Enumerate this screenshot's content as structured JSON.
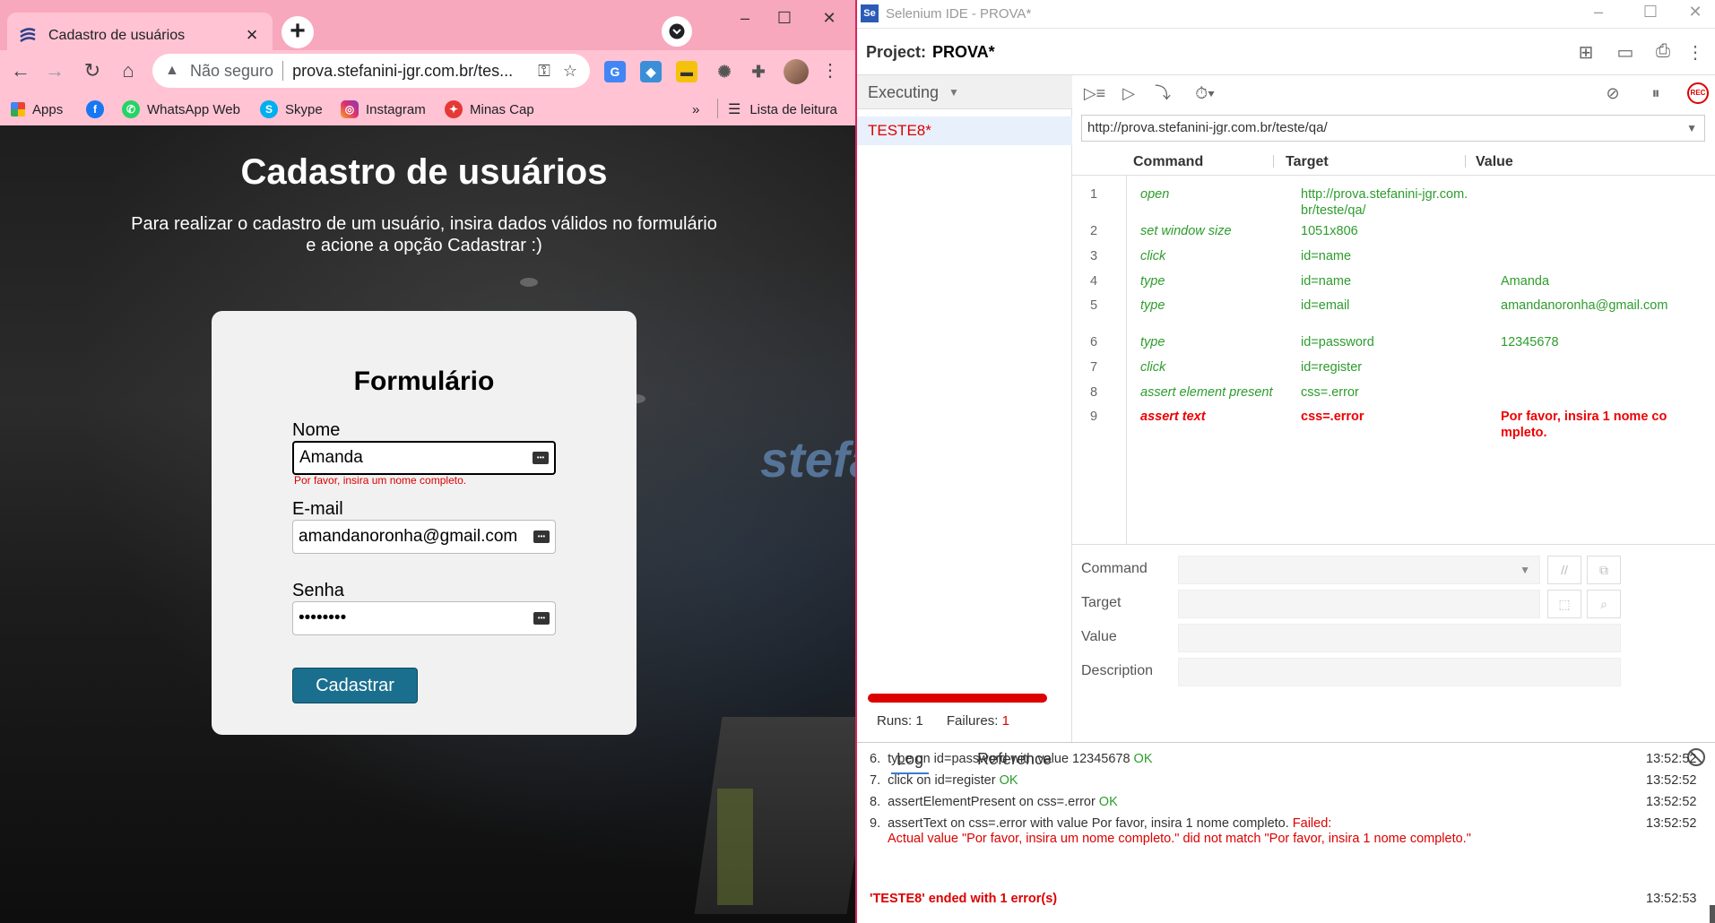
{
  "browser": {
    "tab_title": "Cadastro de usuários",
    "tab_close": "×",
    "new_tab": "+",
    "security_label": "Não seguro",
    "url": "prova.stefanini-jgr.com.br/tes...",
    "bookmarks": [
      "Apps",
      "WhatsApp Web",
      "Skype",
      "Instagram",
      "Minas Cap"
    ],
    "more_bookmarks": "»",
    "reading_list": "Lista de leitura"
  },
  "page": {
    "title": "Cadastro de usuários",
    "subtitle": "Para realizar o cadastro de um usuário, insira dados válidos no formulário e acione a opção Cadastrar :)",
    "form": {
      "heading": "Formulário",
      "name_label": "Nome",
      "name_value": "Amanda",
      "name_error": "Por favor, insira um nome completo.",
      "email_label": "E-mail",
      "email_value": "amandanoronha@gmail.com",
      "password_label": "Senha",
      "password_value": "••••••••",
      "submit_label": "Cadastrar"
    }
  },
  "ide": {
    "window_title": "Selenium IDE - PROVA*",
    "logo": "Se",
    "project_label": "Project:",
    "project_name": "PROVA*",
    "executing_label": "Executing",
    "test_name": "TESTE8*",
    "base_url": "http://prova.stefanini-jgr.com.br/teste/qa/",
    "rec_label": "REC",
    "columns": [
      "Command",
      "Target",
      "Value"
    ],
    "commands": [
      {
        "num": "1",
        "command": "open",
        "target": "http://prova.stefanini-jgr.com.br/teste/qa/",
        "value": "",
        "status": "ok"
      },
      {
        "num": "2",
        "command": "set window size",
        "target": "1051x806",
        "value": "",
        "status": "ok"
      },
      {
        "num": "3",
        "command": "click",
        "target": "id=name",
        "value": "",
        "status": "ok"
      },
      {
        "num": "4",
        "command": "type",
        "target": "id=name",
        "value": "Amanda",
        "status": "ok"
      },
      {
        "num": "5",
        "command": "type",
        "target": "id=email",
        "value": "amandanoronha@gmail.com",
        "status": "ok"
      },
      {
        "num": "6",
        "command": "type",
        "target": "id=password",
        "value": "12345678",
        "status": "ok"
      },
      {
        "num": "7",
        "command": "click",
        "target": "id=register",
        "value": "",
        "status": "ok"
      },
      {
        "num": "8",
        "command": "assert element present",
        "target": "css=.error",
        "value": "",
        "status": "ok"
      },
      {
        "num": "9",
        "command": "assert text",
        "target": "css=.error",
        "value": "Por favor, insira 1 nome completo.",
        "status": "fail"
      }
    ],
    "editor": {
      "command_label": "Command",
      "target_label": "Target",
      "value_label": "Value",
      "description_label": "Description",
      "comment_btn": "//"
    },
    "runs_label": "Runs:",
    "runs_value": "1",
    "failures_label": "Failures:",
    "failures_value": "1",
    "log_tabs": [
      "Log",
      "Reference"
    ],
    "log": [
      {
        "num": "6.",
        "text": "type on id=password with value 12345678",
        "status": "OK",
        "time": "13:52:52"
      },
      {
        "num": "7.",
        "text": "click on id=register",
        "status": "OK",
        "time": "13:52:52"
      },
      {
        "num": "8.",
        "text": "assertElementPresent on css=.error",
        "status": "OK",
        "time": "13:52:52"
      },
      {
        "num": "9.",
        "text": "assertText on css=.error with value Por favor, insira 1 nome completo.",
        "status": "Failed:",
        "detail": "Actual value \"Por favor, insira um nome completo.\" did not match \"Por favor, insira 1 nome completo.\"",
        "time": "13:52:52"
      }
    ],
    "log_end": "'TESTE8' ended with 1 error(s)",
    "log_end_time": "13:52:53"
  },
  "colors": {
    "chrome_frame": "#f7a8bd",
    "chrome_toolbar": "#ffc3d3",
    "submit_button": "#1a6f8e",
    "ok_green": "#2d9c2d",
    "fail_red": "#dd0000"
  }
}
